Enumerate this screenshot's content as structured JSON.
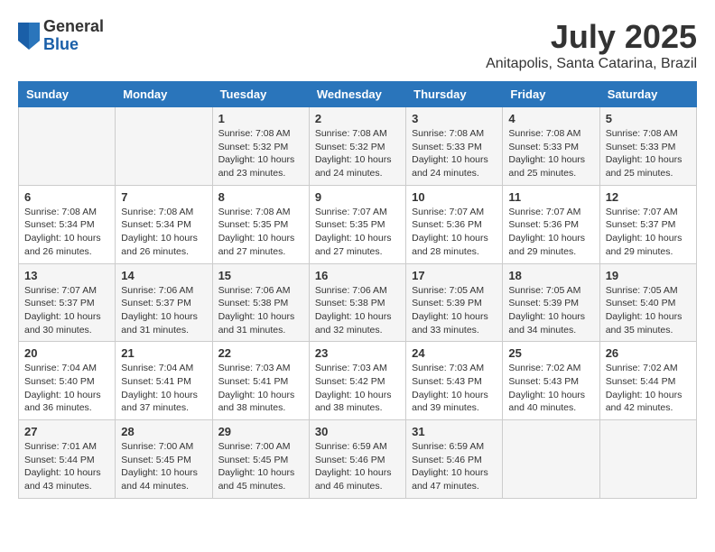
{
  "header": {
    "logo": {
      "general": "General",
      "blue": "Blue"
    },
    "title": "July 2025",
    "subtitle": "Anitapolis, Santa Catarina, Brazil"
  },
  "calendar": {
    "weekdays": [
      "Sunday",
      "Monday",
      "Tuesday",
      "Wednesday",
      "Thursday",
      "Friday",
      "Saturday"
    ],
    "weeks": [
      [
        {
          "day": "",
          "info": ""
        },
        {
          "day": "",
          "info": ""
        },
        {
          "day": "1",
          "info": "Sunrise: 7:08 AM\nSunset: 5:32 PM\nDaylight: 10 hours and 23 minutes."
        },
        {
          "day": "2",
          "info": "Sunrise: 7:08 AM\nSunset: 5:32 PM\nDaylight: 10 hours and 24 minutes."
        },
        {
          "day": "3",
          "info": "Sunrise: 7:08 AM\nSunset: 5:33 PM\nDaylight: 10 hours and 24 minutes."
        },
        {
          "day": "4",
          "info": "Sunrise: 7:08 AM\nSunset: 5:33 PM\nDaylight: 10 hours and 25 minutes."
        },
        {
          "day": "5",
          "info": "Sunrise: 7:08 AM\nSunset: 5:33 PM\nDaylight: 10 hours and 25 minutes."
        }
      ],
      [
        {
          "day": "6",
          "info": "Sunrise: 7:08 AM\nSunset: 5:34 PM\nDaylight: 10 hours and 26 minutes."
        },
        {
          "day": "7",
          "info": "Sunrise: 7:08 AM\nSunset: 5:34 PM\nDaylight: 10 hours and 26 minutes."
        },
        {
          "day": "8",
          "info": "Sunrise: 7:08 AM\nSunset: 5:35 PM\nDaylight: 10 hours and 27 minutes."
        },
        {
          "day": "9",
          "info": "Sunrise: 7:07 AM\nSunset: 5:35 PM\nDaylight: 10 hours and 27 minutes."
        },
        {
          "day": "10",
          "info": "Sunrise: 7:07 AM\nSunset: 5:36 PM\nDaylight: 10 hours and 28 minutes."
        },
        {
          "day": "11",
          "info": "Sunrise: 7:07 AM\nSunset: 5:36 PM\nDaylight: 10 hours and 29 minutes."
        },
        {
          "day": "12",
          "info": "Sunrise: 7:07 AM\nSunset: 5:37 PM\nDaylight: 10 hours and 29 minutes."
        }
      ],
      [
        {
          "day": "13",
          "info": "Sunrise: 7:07 AM\nSunset: 5:37 PM\nDaylight: 10 hours and 30 minutes."
        },
        {
          "day": "14",
          "info": "Sunrise: 7:06 AM\nSunset: 5:37 PM\nDaylight: 10 hours and 31 minutes."
        },
        {
          "day": "15",
          "info": "Sunrise: 7:06 AM\nSunset: 5:38 PM\nDaylight: 10 hours and 31 minutes."
        },
        {
          "day": "16",
          "info": "Sunrise: 7:06 AM\nSunset: 5:38 PM\nDaylight: 10 hours and 32 minutes."
        },
        {
          "day": "17",
          "info": "Sunrise: 7:05 AM\nSunset: 5:39 PM\nDaylight: 10 hours and 33 minutes."
        },
        {
          "day": "18",
          "info": "Sunrise: 7:05 AM\nSunset: 5:39 PM\nDaylight: 10 hours and 34 minutes."
        },
        {
          "day": "19",
          "info": "Sunrise: 7:05 AM\nSunset: 5:40 PM\nDaylight: 10 hours and 35 minutes."
        }
      ],
      [
        {
          "day": "20",
          "info": "Sunrise: 7:04 AM\nSunset: 5:40 PM\nDaylight: 10 hours and 36 minutes."
        },
        {
          "day": "21",
          "info": "Sunrise: 7:04 AM\nSunset: 5:41 PM\nDaylight: 10 hours and 37 minutes."
        },
        {
          "day": "22",
          "info": "Sunrise: 7:03 AM\nSunset: 5:41 PM\nDaylight: 10 hours and 38 minutes."
        },
        {
          "day": "23",
          "info": "Sunrise: 7:03 AM\nSunset: 5:42 PM\nDaylight: 10 hours and 38 minutes."
        },
        {
          "day": "24",
          "info": "Sunrise: 7:03 AM\nSunset: 5:43 PM\nDaylight: 10 hours and 39 minutes."
        },
        {
          "day": "25",
          "info": "Sunrise: 7:02 AM\nSunset: 5:43 PM\nDaylight: 10 hours and 40 minutes."
        },
        {
          "day": "26",
          "info": "Sunrise: 7:02 AM\nSunset: 5:44 PM\nDaylight: 10 hours and 42 minutes."
        }
      ],
      [
        {
          "day": "27",
          "info": "Sunrise: 7:01 AM\nSunset: 5:44 PM\nDaylight: 10 hours and 43 minutes."
        },
        {
          "day": "28",
          "info": "Sunrise: 7:00 AM\nSunset: 5:45 PM\nDaylight: 10 hours and 44 minutes."
        },
        {
          "day": "29",
          "info": "Sunrise: 7:00 AM\nSunset: 5:45 PM\nDaylight: 10 hours and 45 minutes."
        },
        {
          "day": "30",
          "info": "Sunrise: 6:59 AM\nSunset: 5:46 PM\nDaylight: 10 hours and 46 minutes."
        },
        {
          "day": "31",
          "info": "Sunrise: 6:59 AM\nSunset: 5:46 PM\nDaylight: 10 hours and 47 minutes."
        },
        {
          "day": "",
          "info": ""
        },
        {
          "day": "",
          "info": ""
        }
      ]
    ]
  }
}
